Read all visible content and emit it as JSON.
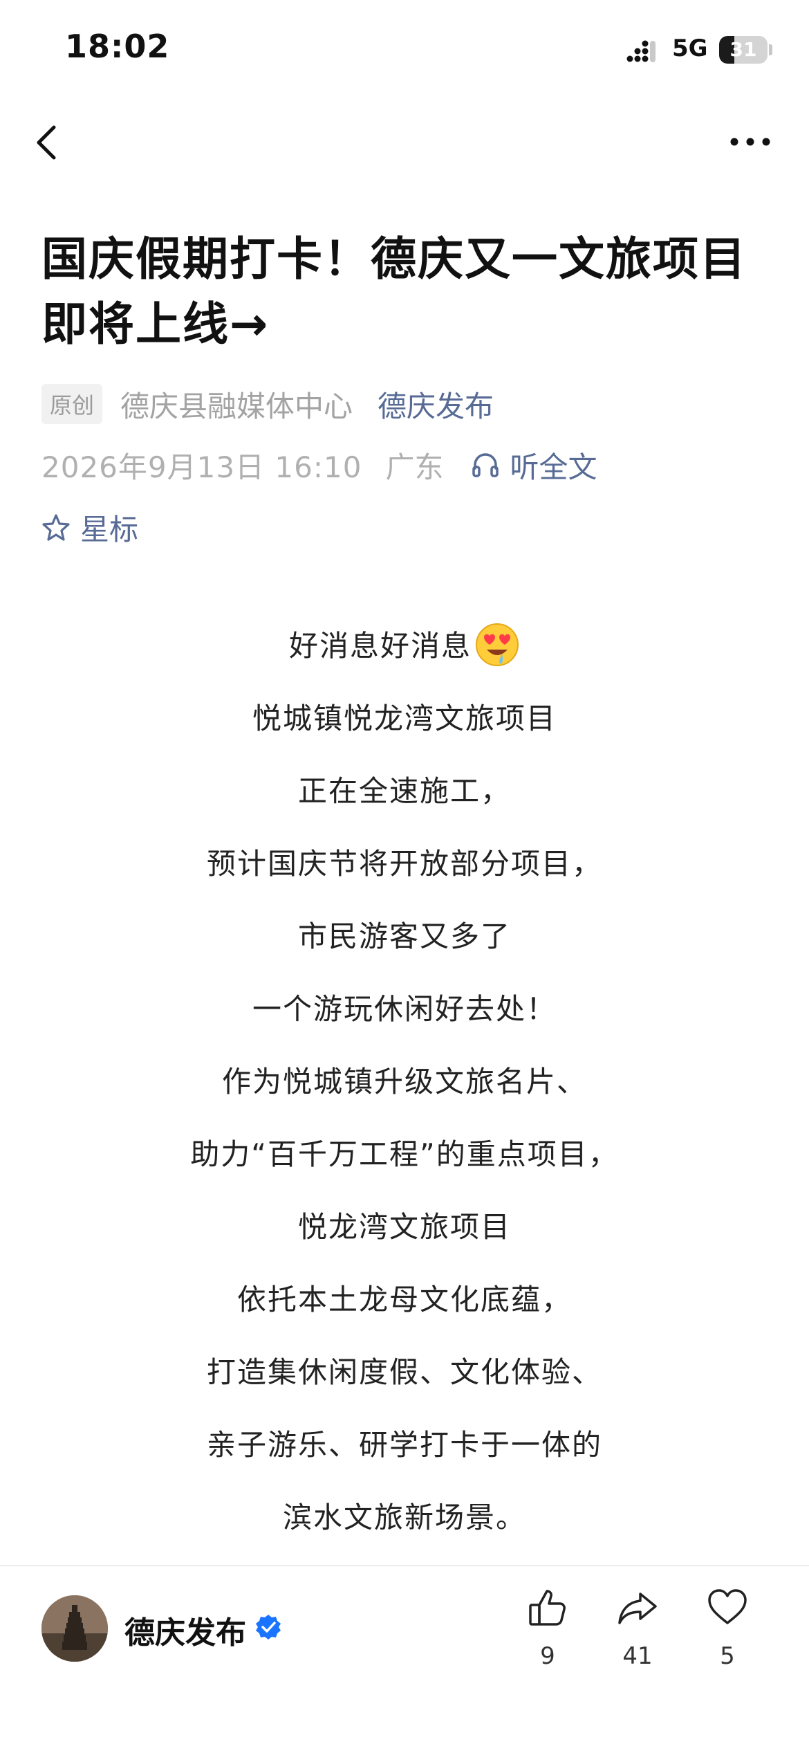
{
  "status_bar": {
    "time": "18:02",
    "network": "5G",
    "battery_level": "31",
    "battery_fraction": 0.31
  },
  "nav": {
    "back_icon": "chevron-left-icon",
    "more_icon": "more-dots-icon"
  },
  "article": {
    "title": "国庆假期打卡！德庆又一文旅项目即将上线→",
    "original_badge": "原创",
    "source": "德庆县融媒体中心",
    "account": "德庆发布",
    "publish_time": "2026年9月13日 16:10",
    "location": "广东",
    "listen_label": "听全文",
    "star_label": "星标",
    "body_lines": [
      "好消息好消息",
      "悦城镇悦龙湾文旅项目",
      "正在全速施工，",
      "预计国庆节将开放部分项目，",
      "市民游客又多了",
      "一个游玩休闲好去处！",
      "作为悦城镇升级文旅名片、",
      "助力“百千万工程”的重点项目，",
      "悦龙湾文旅项目",
      "依托本土龙母文化底蕴，",
      "打造集休闲度假、文化体验、",
      "亲子游乐、研学打卡于一体的",
      "滨水文旅新场景。"
    ]
  },
  "bottom_bar": {
    "account_name": "德庆发布",
    "like_count": "9",
    "share_count": "41",
    "favorite_count": "5"
  },
  "colors": {
    "link": "#576b95",
    "meta_gray": "#b0b0b0",
    "verified_blue": "#1a74ff"
  }
}
